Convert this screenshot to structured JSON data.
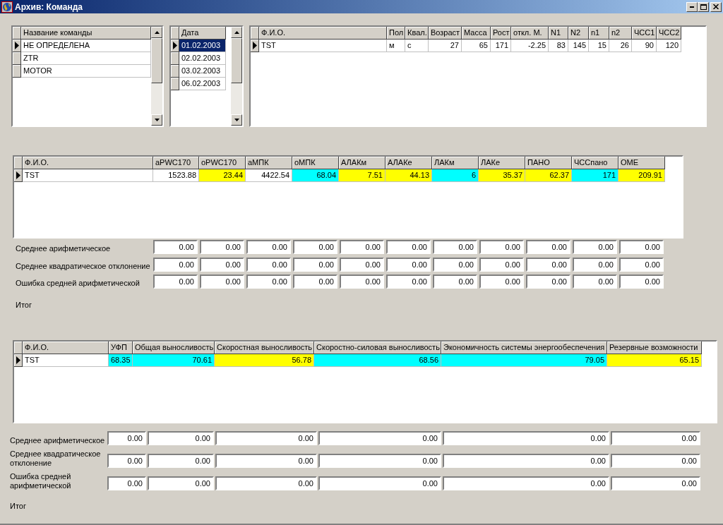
{
  "window": {
    "title": "Архив: Команда"
  },
  "teams": {
    "column": "Название команды",
    "rows": [
      {
        "name": "НЕ ОПРЕДЕЛЕНА",
        "selected": true
      },
      {
        "name": "ZTR",
        "selected": false
      },
      {
        "name": "MOTOR",
        "selected": false
      }
    ]
  },
  "dates": {
    "column": "Дата",
    "rows": [
      {
        "date": "01.02.2003",
        "selected": true
      },
      {
        "date": "02.02.2003",
        "selected": false
      },
      {
        "date": "03.02.2003",
        "selected": false
      },
      {
        "date": "06.02.2003",
        "selected": false
      }
    ]
  },
  "athletes": {
    "columns": [
      "Ф.И.О.",
      "Пол",
      "Квал.",
      "Возраст",
      "Масса",
      "Рост",
      "откл. М.",
      "N1",
      "N2",
      "n1",
      "n2",
      "ЧСС1",
      "ЧСС2"
    ],
    "rows": [
      {
        "selected": true,
        "cells": [
          "TST",
          "м",
          "с",
          "27",
          "65",
          "171",
          "-2.25",
          "83",
          "145",
          "15",
          "26",
          "90",
          "120"
        ]
      }
    ]
  },
  "indices": {
    "columns": [
      "Ф.И.О.",
      "aPWC170",
      "oPWC170",
      "аМПК",
      "оМПК",
      "АЛАКм",
      "АЛАКе",
      "ЛАКм",
      "ЛАКе",
      "ПАНО",
      "ЧССпано",
      "ОМЕ"
    ],
    "rows": [
      {
        "selected": true,
        "cells": [
          {
            "text": "TST",
            "color": "#ffffff"
          },
          {
            "text": "1523.88",
            "color": "#ffffff"
          },
          {
            "text": "23.44",
            "color": "#ffff00"
          },
          {
            "text": "4422.54",
            "color": "#ffffff"
          },
          {
            "text": "68.04",
            "color": "#00ffff"
          },
          {
            "text": "7.51",
            "color": "#ffff00"
          },
          {
            "text": "44.13",
            "color": "#ffff00"
          },
          {
            "text": "6",
            "color": "#00ffff"
          },
          {
            "text": "35.37",
            "color": "#ffff00"
          },
          {
            "text": "62.37",
            "color": "#ffff00"
          },
          {
            "text": "171",
            "color": "#00ffff"
          },
          {
            "text": "209.91",
            "color": "#ffff00"
          }
        ]
      }
    ],
    "stats": [
      {
        "label": "Среднее арифметическое",
        "values": [
          "0.00",
          "0.00",
          "0.00",
          "0.00",
          "0.00",
          "0.00",
          "0.00",
          "0.00",
          "0.00",
          "0.00",
          "0.00"
        ]
      },
      {
        "label": "Среднее квадратическое отклонение",
        "values": [
          "0.00",
          "0.00",
          "0.00",
          "0.00",
          "0.00",
          "0.00",
          "0.00",
          "0.00",
          "0.00",
          "0.00",
          "0.00"
        ]
      },
      {
        "label": "Ошибка средней арифметической",
        "values": [
          "0.00",
          "0.00",
          "0.00",
          "0.00",
          "0.00",
          "0.00",
          "0.00",
          "0.00",
          "0.00",
          "0.00",
          "0.00"
        ]
      }
    ],
    "total": "Итог"
  },
  "abilities": {
    "columns": [
      "Ф.И.О.",
      "УФП",
      "Общая выносливость",
      "Скоростная выносливость",
      "Скоростно-силовая выносливость",
      "Экономичность системы энергообеспечения",
      "Резервные возможности"
    ],
    "rows": [
      {
        "selected": true,
        "cells": [
          {
            "text": "TST",
            "color": "#ffffff"
          },
          {
            "text": "68.35",
            "color": "#00ffff"
          },
          {
            "text": "70.61",
            "color": "#00ffff"
          },
          {
            "text": "56.78",
            "color": "#ffff00"
          },
          {
            "text": "68.56",
            "color": "#00ffff"
          },
          {
            "text": "79.05",
            "color": "#00ffff"
          },
          {
            "text": "65.15",
            "color": "#ffff00"
          }
        ]
      }
    ],
    "stats": [
      {
        "label": "Среднее арифметическое",
        "values": [
          "0.00",
          "0.00",
          "0.00",
          "0.00",
          "0.00",
          "0.00"
        ]
      },
      {
        "label": "Среднее квадратическое отклонение",
        "values": [
          "0.00",
          "0.00",
          "0.00",
          "0.00",
          "0.00",
          "0.00"
        ]
      },
      {
        "label": "Ошибка средней арифметической",
        "values": [
          "0.00",
          "0.00",
          "0.00",
          "0.00",
          "0.00",
          "0.00"
        ]
      }
    ],
    "total": "Итог"
  }
}
